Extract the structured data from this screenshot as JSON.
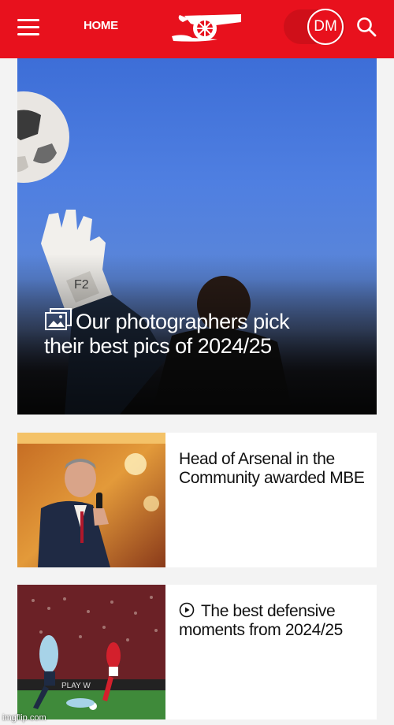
{
  "header": {
    "menu_icon": "hamburger-menu-icon",
    "home_label": "HOME",
    "logo_icon": "arsenal-cannon-logo",
    "avatar_initials": "DM",
    "search_icon": "search-icon",
    "brand_color": "#e8111d"
  },
  "hero": {
    "icon": "photo-gallery-icon",
    "title": "Our photographers pick their best pics of 2024/25"
  },
  "articles": [
    {
      "title": "Head of Arsenal in the Community awarded MBE"
    },
    {
      "icon": "play-video-icon",
      "title": "The best defensive moments from 2024/25"
    }
  ],
  "watermark": "imgflip.com"
}
